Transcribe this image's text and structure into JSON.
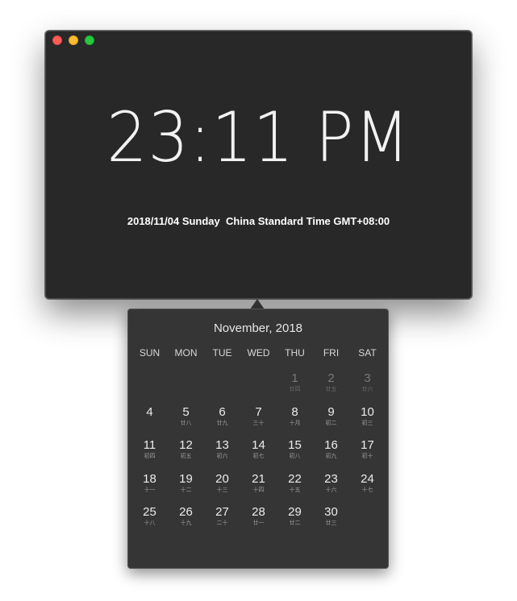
{
  "clock": {
    "time": "23:11 PM",
    "info": "2018/11/04 Sunday  China Standard Time GMT+08:00"
  },
  "calendar": {
    "title": "November, 2018",
    "weekdays": [
      "SUN",
      "MON",
      "TUE",
      "WED",
      "THU",
      "FRI",
      "SAT"
    ],
    "days": [
      {
        "num": "",
        "lunar": "",
        "empty": true
      },
      {
        "num": "",
        "lunar": "",
        "empty": true
      },
      {
        "num": "",
        "lunar": "",
        "empty": true
      },
      {
        "num": "",
        "lunar": "",
        "empty": true
      },
      {
        "num": "1",
        "lunar": "廿四",
        "dim": true
      },
      {
        "num": "2",
        "lunar": "廿五",
        "dim": true
      },
      {
        "num": "3",
        "lunar": "廿六",
        "dim": true
      },
      {
        "num": "4",
        "lunar": ""
      },
      {
        "num": "5",
        "lunar": "廿八"
      },
      {
        "num": "6",
        "lunar": "廿九"
      },
      {
        "num": "7",
        "lunar": "三十"
      },
      {
        "num": "8",
        "lunar": "十月"
      },
      {
        "num": "9",
        "lunar": "初二"
      },
      {
        "num": "10",
        "lunar": "初三"
      },
      {
        "num": "11",
        "lunar": "初四"
      },
      {
        "num": "12",
        "lunar": "初五"
      },
      {
        "num": "13",
        "lunar": "初六"
      },
      {
        "num": "14",
        "lunar": "初七"
      },
      {
        "num": "15",
        "lunar": "初八"
      },
      {
        "num": "16",
        "lunar": "初九"
      },
      {
        "num": "17",
        "lunar": "初十"
      },
      {
        "num": "18",
        "lunar": "十一"
      },
      {
        "num": "19",
        "lunar": "十二"
      },
      {
        "num": "20",
        "lunar": "十三"
      },
      {
        "num": "21",
        "lunar": "十四"
      },
      {
        "num": "22",
        "lunar": "十五"
      },
      {
        "num": "23",
        "lunar": "十六"
      },
      {
        "num": "24",
        "lunar": "十七"
      },
      {
        "num": "25",
        "lunar": "十八"
      },
      {
        "num": "26",
        "lunar": "十九"
      },
      {
        "num": "27",
        "lunar": "二十"
      },
      {
        "num": "28",
        "lunar": "廿一"
      },
      {
        "num": "29",
        "lunar": "廿二"
      },
      {
        "num": "30",
        "lunar": "廿三"
      }
    ]
  }
}
